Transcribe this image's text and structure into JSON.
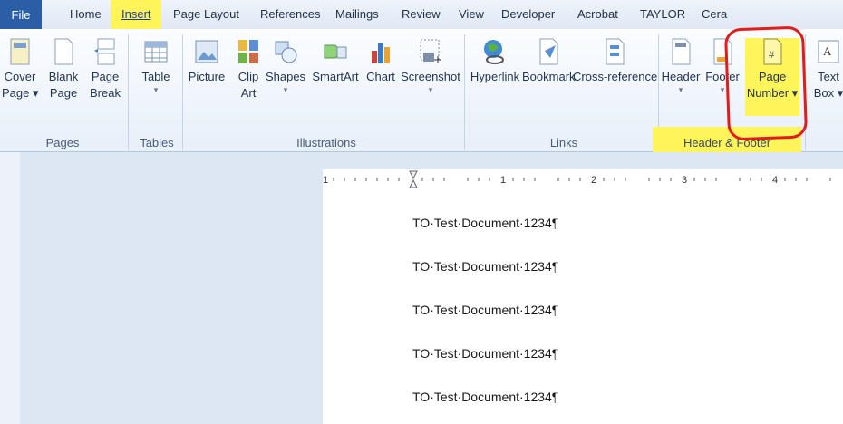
{
  "tabs": [
    "File",
    "Home",
    "Insert",
    "Page Layout",
    "References",
    "Mailings",
    "Review",
    "View",
    "Developer",
    "Acrobat",
    "TAYLOR",
    "Cera"
  ],
  "ribbon": {
    "pages": {
      "cover": [
        "Cover",
        "Page ▾"
      ],
      "blank": [
        "Blank",
        "Page"
      ],
      "break": [
        "Page",
        "Break"
      ],
      "group": "Pages"
    },
    "tables": {
      "table": [
        "Table",
        "▾"
      ],
      "group": "Tables"
    },
    "illustrations": {
      "picture": "Picture",
      "clipart": [
        "Clip",
        "Art"
      ],
      "shapes": [
        "Shapes",
        "▾"
      ],
      "smartart": "SmartArt",
      "chart": "Chart",
      "screenshot": [
        "Screenshot",
        "▾"
      ],
      "group": "Illustrations"
    },
    "links": {
      "hyperlink": "Hyperlink",
      "bookmark": "Bookmark",
      "crossref": "Cross-reference",
      "group": "Links"
    },
    "header_footer": {
      "header": [
        "Header",
        "▾"
      ],
      "footer": [
        "Footer",
        "▾"
      ],
      "page_number": [
        "Page",
        "Number ▾"
      ],
      "group": "Header & Footer"
    },
    "text": {
      "textbox": [
        "Text",
        "Box ▾"
      ]
    }
  },
  "document": {
    "lines": [
      "TO·Test·Document·1234¶",
      "TO·Test·Document·1234¶",
      "TO·Test·Document·1234¶",
      "TO·Test·Document·1234¶",
      "TO·Test·Document·1234¶"
    ]
  },
  "ruler": {
    "numbers": [
      "1",
      "1",
      "2",
      "3",
      "4"
    ]
  }
}
